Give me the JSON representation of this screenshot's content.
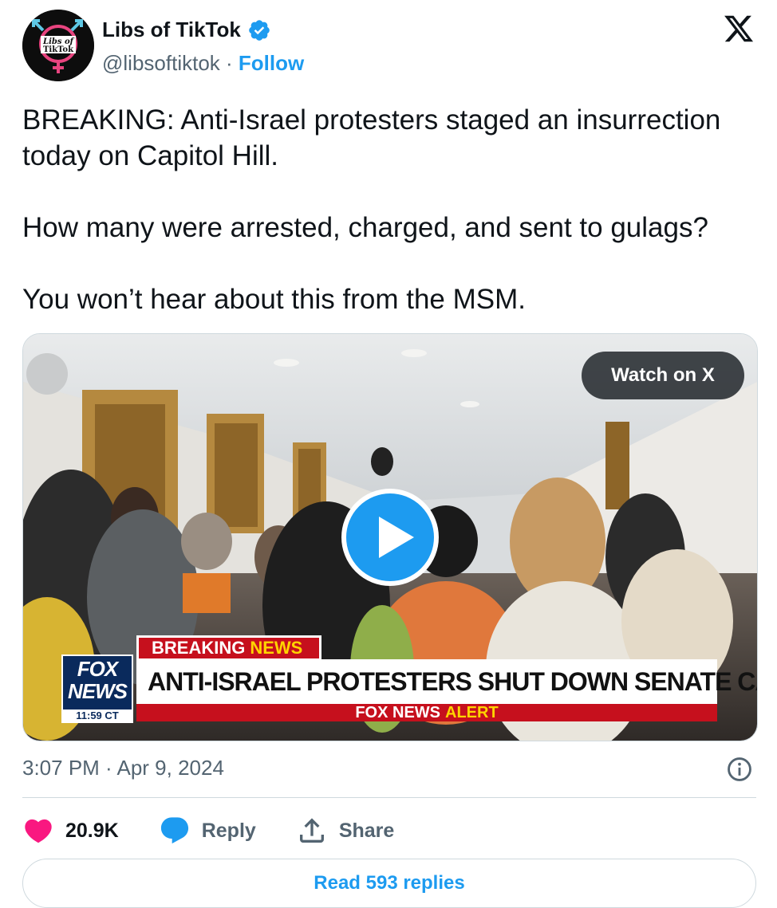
{
  "author": {
    "name": "Libs of TikTok",
    "handle": "@libsoftiktok",
    "separator": "·",
    "follow_label": "Follow",
    "avatar_text_line1": "Libs of",
    "avatar_text_line2": "TikTok",
    "verified_icon": "verified-badge-icon"
  },
  "platform_icon": "x-logo-icon",
  "tweet": {
    "paragraphs": [
      "BREAKING: Anti-Israel protesters staged an insurrection today on Capitol Hill.",
      "How many were arrested, charged, and sent to gulags?",
      "You won’t hear about this from the MSM."
    ]
  },
  "media": {
    "watch_label": "Watch on X",
    "play_icon": "play-icon",
    "lower_third": {
      "breaking_word": "BREAKING",
      "news_word": "NEWS",
      "headline": "ANTI-ISRAEL PROTESTERS SHUT DOWN SENATE CAFETERIA",
      "alert_brand": "FOX NEWS",
      "alert_word": "ALERT",
      "logo_line1": "FOX",
      "logo_line2": "NEWS",
      "logo_time": "11:59 CT"
    }
  },
  "meta": {
    "timestamp": "3:07 PM · Apr 9, 2024",
    "info_icon": "info-icon"
  },
  "actions": {
    "like_count": "20.9K",
    "reply_label": "Reply",
    "share_label": "Share"
  },
  "read_replies_label": "Read 593 replies",
  "colors": {
    "accent": "#1d9bf0",
    "like": "#f91880",
    "text": "#0f1419",
    "secondary": "#536471",
    "fox_red": "#c6101d",
    "fox_yellow": "#ffd400"
  }
}
